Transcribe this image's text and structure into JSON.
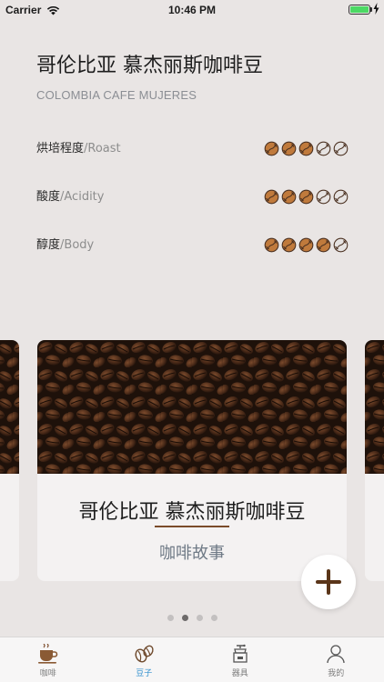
{
  "status_bar": {
    "carrier": "Carrier",
    "time": "10:46 PM",
    "battery_level": 1.0
  },
  "coffee": {
    "name_zh": "哥伦比亚 慕杰丽斯咖啡豆",
    "name_en": "COLOMBIA CAFE MUJERES",
    "attributes": [
      {
        "label_zh": "烘培程度",
        "label_en": "/Roast",
        "rating": 3,
        "max": 5
      },
      {
        "label_zh": "酸度",
        "label_en": "/Acidity",
        "rating": 3,
        "max": 5
      },
      {
        "label_zh": "醇度",
        "label_en": "/Body",
        "rating": 4,
        "max": 5
      }
    ]
  },
  "card": {
    "title": "哥伦比亚 慕杰丽斯咖啡豆",
    "subtitle": "咖啡故事"
  },
  "pager": {
    "count": 4,
    "active_index": 1
  },
  "tabs": [
    {
      "label": "咖啡",
      "icon": "coffee-cup-icon",
      "active": false
    },
    {
      "label": "豆子",
      "icon": "beans-icon",
      "active": true
    },
    {
      "label": "器具",
      "icon": "grinder-icon",
      "active": false
    },
    {
      "label": "我的",
      "icon": "person-icon",
      "active": false
    }
  ],
  "colors": {
    "accent": "#7a4b2a",
    "tab_active": "#2f8fce",
    "bean_filled": "#c07a3c",
    "bean_empty": "#e6e3e2"
  }
}
